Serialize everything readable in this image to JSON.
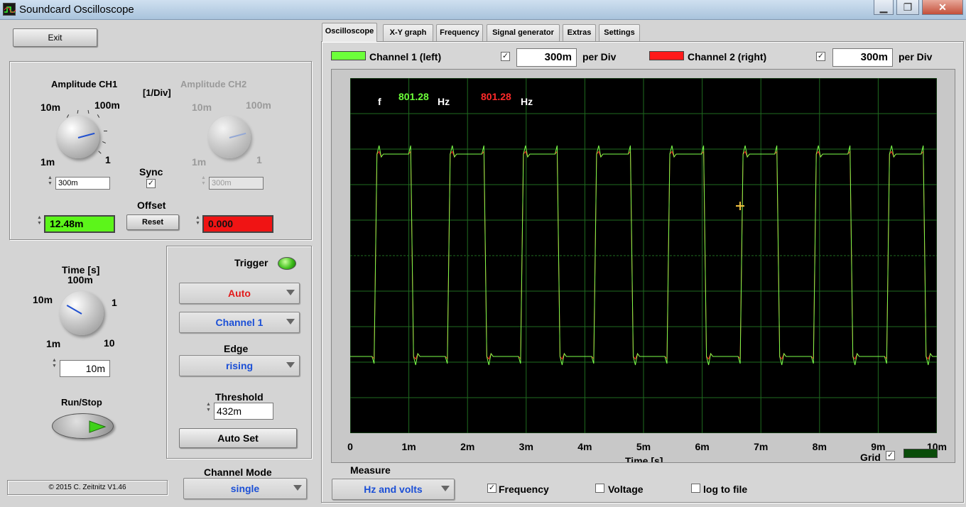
{
  "window": {
    "title": "Soundcard Oscilloscope",
    "controls": {
      "minimize": "▁",
      "maximize": "❐",
      "close": "✕"
    }
  },
  "left": {
    "exit_label": "Exit",
    "amp_ch1_label": "Amplitude CH1",
    "amp_unit_label": "[1/Div]",
    "amp_ch2_label": "Amplitude CH2",
    "knob_ch1": {
      "top_left": "10m",
      "top_right": "100m",
      "bottom_left": "1m",
      "bottom_right": "1"
    },
    "knob_ch2": {
      "top_left": "10m",
      "top_right": "100m",
      "bottom_left": "1m",
      "bottom_right": "1"
    },
    "amp_ch1_value": "300m",
    "amp_ch2_value": "300m",
    "sync_label": "Sync",
    "sync_checked": "✓",
    "offset_label": "Offset",
    "offset_ch1": "12.48m",
    "offset_ch2": "0.000",
    "reset_label": "Reset",
    "time_label": "Time [s]",
    "knob_time": {
      "top": "100m",
      "top_left": "10m",
      "top_right": "1",
      "bottom_left": "1m",
      "bottom_right": "10"
    },
    "time_value": "10m",
    "run_stop_label": "Run/Stop",
    "copyright": "© 2015  C. Zeitnitz V1.46",
    "channel_mode_label": "Channel Mode",
    "channel_mode_value": "single"
  },
  "trigger": {
    "label": "Trigger",
    "mode": "Auto",
    "channel": "Channel 1",
    "edge_label": "Edge",
    "edge": "rising",
    "threshold_label": "Threshold",
    "threshold": "432m",
    "autoset_label": "Auto Set"
  },
  "tabs": [
    "Oscilloscope",
    "X-Y graph",
    "Frequency",
    "Signal generator",
    "Extras",
    "Settings"
  ],
  "channels": {
    "ch1_label": "Channel 1 (left)",
    "ch1_div": "300m",
    "ch2_label": "Channel 2 (right)",
    "ch2_div": "300m",
    "per_div": "per Div",
    "check": "✓",
    "ch1_color": "#6cff3a",
    "ch2_color": "#ff1a1a"
  },
  "plot": {
    "f_label": "f",
    "freq_ch1": "801.28",
    "freq_ch2": "801.28",
    "hz": "Hz",
    "x_ticks": [
      "0",
      "1m",
      "2m",
      "3m",
      "4m",
      "5m",
      "6m",
      "7m",
      "8m",
      "9m",
      "10m"
    ],
    "xlabel": "Time [s]",
    "grid_label": "Grid",
    "grid_checked": "✓",
    "grid_color": "#0a4d0a"
  },
  "chart_data": {
    "type": "line",
    "xlabel": "Time [s]",
    "x_range": [
      0,
      0.01
    ],
    "grid": true,
    "x_ticks": [
      "0",
      "1m",
      "2m",
      "3m",
      "4m",
      "5m",
      "6m",
      "7m",
      "8m",
      "9m",
      "10m"
    ],
    "series": [
      {
        "name": "Channel 1 (left)",
        "color": "#6cff3a",
        "waveform": "square",
        "frequency_hz": 801.28
      },
      {
        "name": "Channel 2 (right)",
        "color": "#ff1a1a",
        "waveform": "square",
        "frequency_hz": 801.28
      }
    ]
  },
  "measure": {
    "label": "Measure",
    "mode": "Hz and volts",
    "frequency_label": "Frequency",
    "frequency_checked": "✓",
    "voltage_label": "Voltage",
    "logfile_label": "log to file"
  }
}
